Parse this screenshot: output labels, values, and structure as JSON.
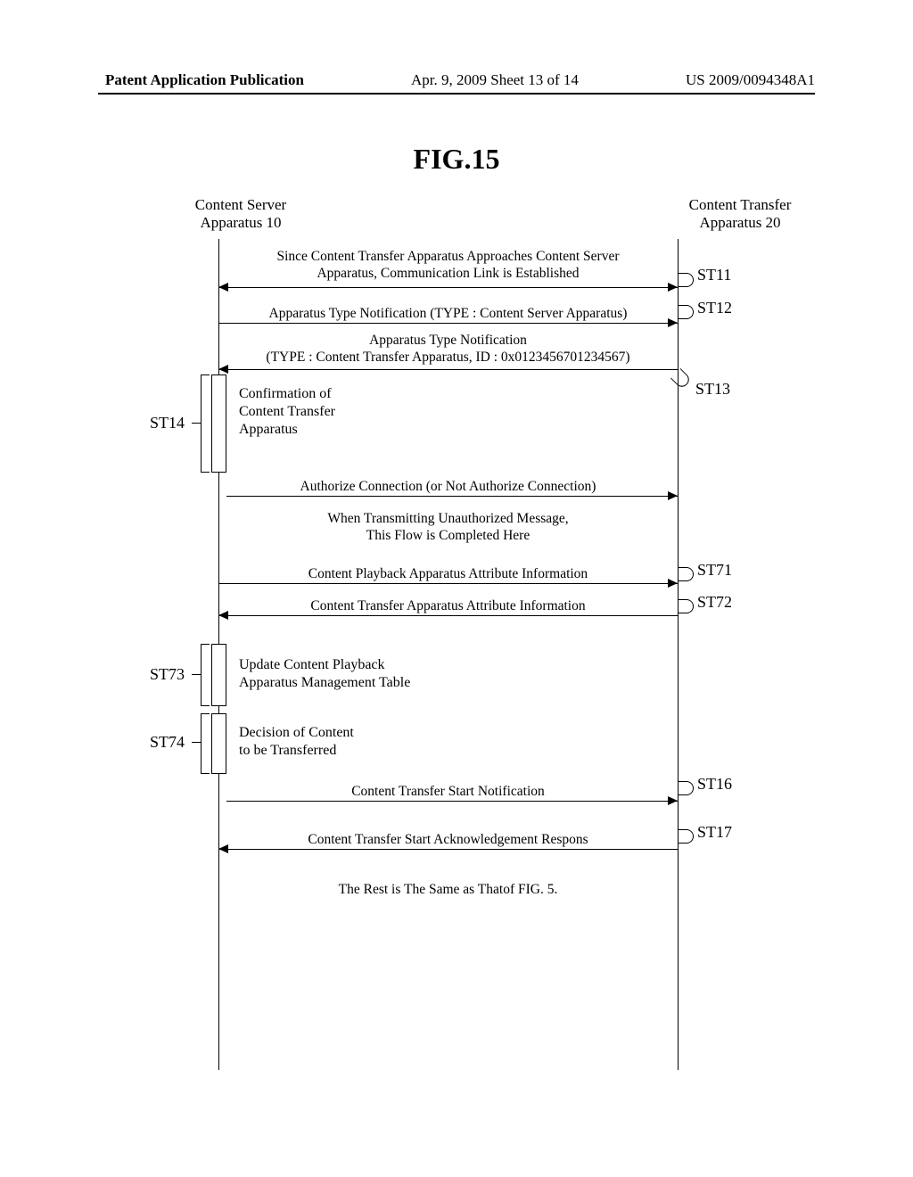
{
  "header": {
    "left": "Patent Application Publication",
    "center": "Apr. 9, 2009  Sheet 13 of 14",
    "right": "US 2009/0094348A1"
  },
  "figure_title": "FIG.15",
  "lifelines": {
    "left": "Content Server\nApparatus 10",
    "right": "Content Transfer\nApparatus 20"
  },
  "messages": {
    "st11": "Since Content Transfer Apparatus Approaches Content Server\nApparatus, Communication Link is Established",
    "st12": "Apparatus Type Notification (TYPE : Content Server Apparatus)",
    "st13": "Apparatus Type Notification\n(TYPE : Content Transfer Apparatus, ID : 0x0123456701234567)",
    "authorize": "Authorize Connection (or Not Authorize Connection)",
    "unauthorized_note": "When Transmitting Unauthorized Message,\nThis Flow is Completed Here",
    "st71": "Content Playback Apparatus Attribute Information",
    "st72": "Content Transfer Apparatus Attribute Information",
    "st16": "Content Transfer Start Notification",
    "st17": "Content Transfer Start Acknowledgement Respons",
    "rest_note": "The Rest is The Same as Thatof FIG. 5."
  },
  "activations": {
    "st14": "Confirmation of\nContent Transfer\nApparatus",
    "st73": "Update Content Playback\nApparatus Management Table",
    "st74": "Decision of Content\nto be Transferred"
  },
  "step_labels": {
    "st11": "ST11",
    "st12": "ST12",
    "st13": "ST13",
    "st14": "ST14",
    "st71": "ST71",
    "st72": "ST72",
    "st73": "ST73",
    "st74": "ST74",
    "st16": "ST16",
    "st17": "ST17"
  }
}
